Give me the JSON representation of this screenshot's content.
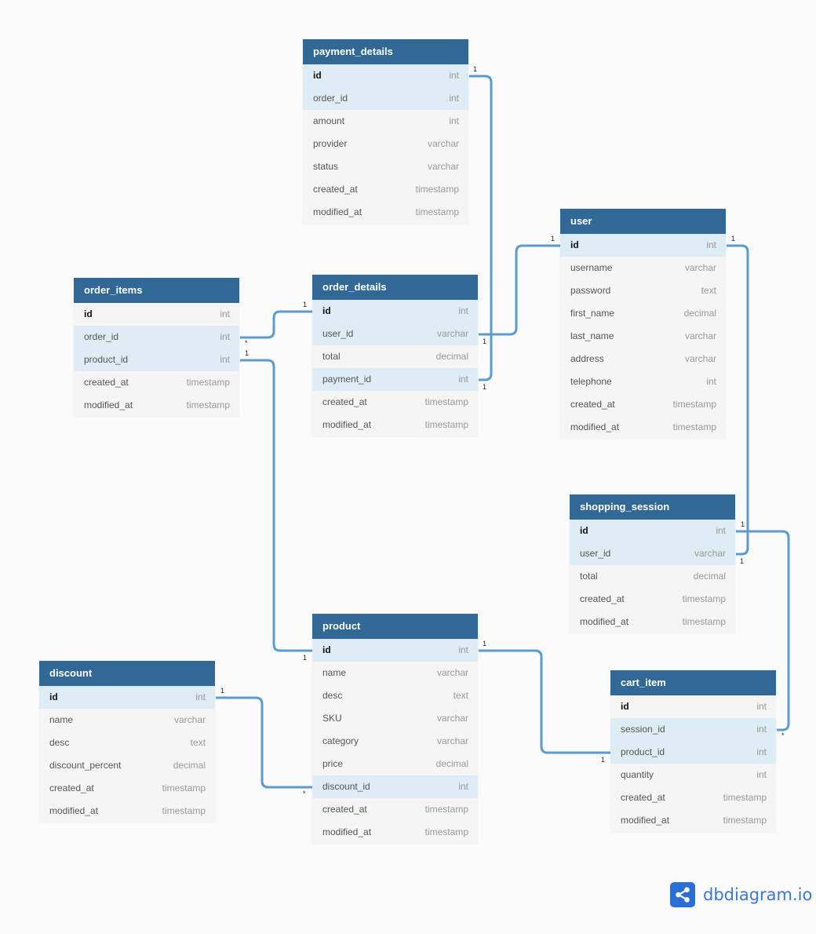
{
  "tables": [
    {
      "name": "payment_details",
      "fields": [
        {
          "name": "id",
          "type": "int",
          "pk": true,
          "fk": true
        },
        {
          "name": "order_id",
          "type": "int",
          "fk": true
        },
        {
          "name": "amount",
          "type": "int"
        },
        {
          "name": "provider",
          "type": "varchar"
        },
        {
          "name": "status",
          "type": "varchar"
        },
        {
          "name": "created_at",
          "type": "timestamp"
        },
        {
          "name": "modified_at",
          "type": "timestamp"
        }
      ]
    },
    {
      "name": "user",
      "fields": [
        {
          "name": "id",
          "type": "int",
          "pk": true,
          "fk": true
        },
        {
          "name": "username",
          "type": "varchar"
        },
        {
          "name": "password",
          "type": "text"
        },
        {
          "name": "first_name",
          "type": "decimal"
        },
        {
          "name": "last_name",
          "type": "varchar"
        },
        {
          "name": "address",
          "type": "varchar"
        },
        {
          "name": "telephone",
          "type": "int"
        },
        {
          "name": "created_at",
          "type": "timestamp"
        },
        {
          "name": "modified_at",
          "type": "timestamp"
        }
      ]
    },
    {
      "name": "order_items",
      "fields": [
        {
          "name": "id",
          "type": "int",
          "pk": true
        },
        {
          "name": "order_id",
          "type": "int",
          "fk": true
        },
        {
          "name": "product_id",
          "type": "int",
          "fk": true
        },
        {
          "name": "created_at",
          "type": "timestamp"
        },
        {
          "name": "modified_at",
          "type": "timestamp"
        }
      ]
    },
    {
      "name": "order_details",
      "fields": [
        {
          "name": "id",
          "type": "int",
          "pk": true,
          "fk": true
        },
        {
          "name": "user_id",
          "type": "varchar",
          "fk": true
        },
        {
          "name": "total",
          "type": "decimal"
        },
        {
          "name": "payment_id",
          "type": "int",
          "fk": true
        },
        {
          "name": "created_at",
          "type": "timestamp"
        },
        {
          "name": "modified_at",
          "type": "timestamp"
        }
      ]
    },
    {
      "name": "shopping_session",
      "fields": [
        {
          "name": "id",
          "type": "int",
          "pk": true,
          "fk": true
        },
        {
          "name": "user_id",
          "type": "varchar",
          "fk": true
        },
        {
          "name": "total",
          "type": "decimal"
        },
        {
          "name": "created_at",
          "type": "timestamp"
        },
        {
          "name": "modified_at",
          "type": "timestamp"
        }
      ]
    },
    {
      "name": "product",
      "fields": [
        {
          "name": "id",
          "type": "int",
          "pk": true,
          "fk": true
        },
        {
          "name": "name",
          "type": "varchar"
        },
        {
          "name": "desc",
          "type": "text"
        },
        {
          "name": "SKU",
          "type": "varchar"
        },
        {
          "name": "category",
          "type": "varchar"
        },
        {
          "name": "price",
          "type": "decimal"
        },
        {
          "name": "discount_id",
          "type": "int",
          "fk": true
        },
        {
          "name": "created_at",
          "type": "timestamp"
        },
        {
          "name": "modified_at",
          "type": "timestamp"
        }
      ]
    },
    {
      "name": "discount",
      "fields": [
        {
          "name": "id",
          "type": "int",
          "pk": true,
          "fk": true
        },
        {
          "name": "name",
          "type": "varchar"
        },
        {
          "name": "desc",
          "type": "text"
        },
        {
          "name": "discount_percent",
          "type": "decimal"
        },
        {
          "name": "created_at",
          "type": "timestamp"
        },
        {
          "name": "modified_at",
          "type": "timestamp"
        }
      ]
    },
    {
      "name": "cart_item",
      "fields": [
        {
          "name": "id",
          "type": "int",
          "pk": true
        },
        {
          "name": "session_id",
          "type": "int",
          "fk": true
        },
        {
          "name": "product_id",
          "type": "int",
          "fk": true
        },
        {
          "name": "quantity",
          "type": "int"
        },
        {
          "name": "created_at",
          "type": "timestamp"
        },
        {
          "name": "modified_at",
          "type": "timestamp"
        }
      ]
    }
  ],
  "relationships": [
    {
      "from": "payment_details.id",
      "to": "order_details.payment_id",
      "from_card": "1",
      "to_card": "1"
    },
    {
      "from": "user.id",
      "to": "order_details.user_id",
      "from_card": "1",
      "to_card": "1"
    },
    {
      "from": "order_details.id",
      "to": "order_items.order_id",
      "from_card": "1",
      "to_card": "*"
    },
    {
      "from": "product.id",
      "to": "order_items.product_id",
      "from_card": "1",
      "to_card": "1"
    },
    {
      "from": "user.id",
      "to": "shopping_session.user_id",
      "from_card": "1",
      "to_card": "1"
    },
    {
      "from": "shopping_session.id",
      "to": "cart_item.session_id",
      "from_card": "1",
      "to_card": "*"
    },
    {
      "from": "product.id",
      "to": "cart_item.product_id",
      "from_card": "1",
      "to_card": "1"
    },
    {
      "from": "discount.id",
      "to": "product.discount_id",
      "from_card": "1",
      "to_card": "*"
    }
  ],
  "brand": {
    "name": "dbdiagram.io",
    "color": "#2a6fd6",
    "line_color": "#5b9bd0",
    "header_color": "#316896"
  }
}
